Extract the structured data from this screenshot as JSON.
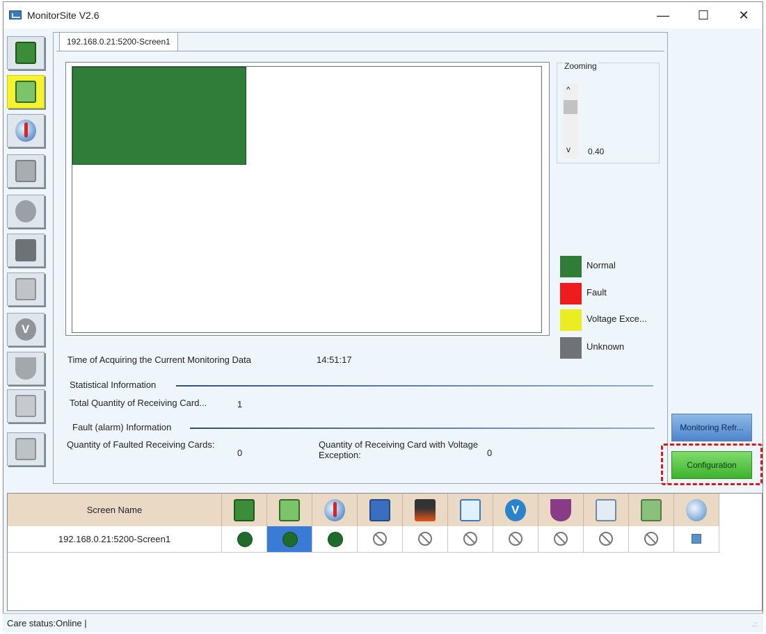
{
  "window": {
    "title": "MonitorSite V2.6",
    "minimize": "—",
    "maximize": "☐",
    "close": "✕"
  },
  "toolbar": {
    "items": [
      {
        "name": "receiving-card-status",
        "icon": "receiving-card-icon",
        "active": false
      },
      {
        "name": "receiving-card-monitor",
        "icon": "card-monitor-icon",
        "active": true
      },
      {
        "name": "temperature",
        "icon": "thermometer-icon",
        "active": false
      },
      {
        "name": "power",
        "icon": "power-card-icon",
        "active": false
      },
      {
        "name": "humidity",
        "icon": "humidity-drop-icon",
        "active": false
      },
      {
        "name": "smoke",
        "icon": "smoke-icon",
        "active": false
      },
      {
        "name": "fan",
        "icon": "fan-icon",
        "active": false
      },
      {
        "name": "voltage",
        "icon": "voltage-icon",
        "active": false
      },
      {
        "name": "magnet",
        "icon": "magnet-icon",
        "active": false
      },
      {
        "name": "door",
        "icon": "door-icon",
        "active": false
      },
      {
        "name": "module-strip",
        "icon": "module-strip-icon",
        "active": false
      }
    ]
  },
  "tab": {
    "label": "192.168.0.21:5200-Screen1"
  },
  "zoom": {
    "label": "Zooming",
    "up": "^",
    "down": "v",
    "value": "0.40"
  },
  "legend": [
    {
      "label": "Normal",
      "color": "#2f7d39"
    },
    {
      "label": "Fault",
      "color": "#ee1c1c"
    },
    {
      "label": "Voltage Exce...",
      "color": "#ecec22"
    },
    {
      "label": "Unknown",
      "color": "#6f7378"
    }
  ],
  "monitoring": {
    "time_label": "Time of Acquiring the Current Monitoring Data",
    "time_value": "14:51:17",
    "stat_header": "Statistical Information",
    "total_label": "Total Quantity of Receiving Card...",
    "total_value": "1",
    "fault_header": "Fault (alarm) Information",
    "faulted_label": "Quantity of Faulted Receiving Cards:",
    "faulted_value": "0",
    "voltage_label": "Quantity of Receiving Card with Voltage Exception:",
    "voltage_value": "0"
  },
  "buttons": {
    "monitoring_refresh": "Monitoring Refr...",
    "configuration": "Configuration"
  },
  "grid": {
    "header_name": "Screen Name",
    "columns": [
      {
        "icon": "receiving-card-icon",
        "glyph": "g-board"
      },
      {
        "icon": "card-monitor-icon",
        "glyph": "g-card"
      },
      {
        "icon": "thermometer-icon",
        "glyph": "g-temp"
      },
      {
        "icon": "power-card-icon",
        "glyph": "g-pwr-blue"
      },
      {
        "icon": "smoke-icon",
        "glyph": "g-smoke-col"
      },
      {
        "icon": "fan-icon",
        "glyph": "g-fan-col"
      },
      {
        "icon": "voltage-icon",
        "glyph": "g-v-col"
      },
      {
        "icon": "magnet-icon",
        "glyph": "g-mag-col"
      },
      {
        "icon": "door-icon",
        "glyph": "g-door-col"
      },
      {
        "icon": "module-strip-icon",
        "glyph": "g-strip-col"
      },
      {
        "icon": "globe-icon",
        "glyph": "g-globe"
      }
    ],
    "rows": [
      {
        "name": "192.168.0.21:5200-Screen1",
        "cells": [
          "ok",
          "ok-selected",
          "ok",
          "na",
          "na",
          "na",
          "na",
          "na",
          "na",
          "na",
          "web"
        ]
      }
    ]
  },
  "status": {
    "text": "Care status:Online  |"
  }
}
